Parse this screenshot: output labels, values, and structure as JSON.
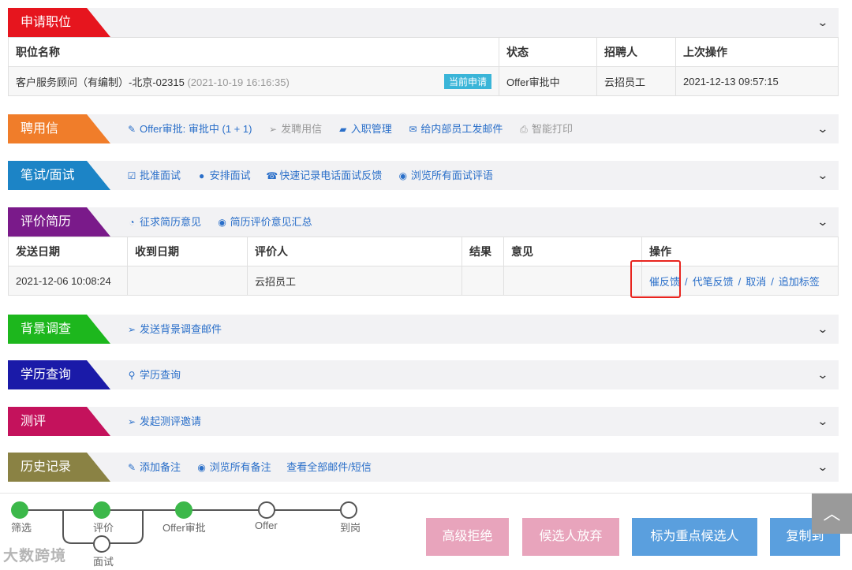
{
  "colors": {
    "apply": "#e6151e",
    "offer": "#f07d2a",
    "interview": "#1c84c6",
    "review": "#7a1a8a",
    "background": "#1db71d",
    "education": "#1a1aa8",
    "assessment": "#c4125c",
    "history": "#8a8244",
    "link": "#2a6fc9",
    "done_node": "#3cb84a"
  },
  "apply": {
    "title": "申请职位",
    "headers": [
      "职位名称",
      "状态",
      "招聘人",
      "上次操作"
    ],
    "row": {
      "position": "客户服务顾问（有编制）-北京-02315",
      "applied_time": "(2021-10-19 16:16:35)",
      "badge": "当前申请",
      "status": "Offer审批中",
      "recruiter": "云招员工",
      "last_action": "2021-12-13 09:57:15"
    }
  },
  "offer": {
    "title": "聘用信",
    "links": [
      {
        "icon": "edit-icon",
        "label": "Offer审批: 审批中 (1 + 1)"
      },
      {
        "icon": "send-icon",
        "label": "发聘用信"
      },
      {
        "icon": "briefcase-icon",
        "label": "入职管理"
      },
      {
        "icon": "mail-icon",
        "label": "给内部员工发邮件"
      },
      {
        "icon": "print-icon",
        "label": "智能打印"
      }
    ]
  },
  "interview": {
    "title": "笔试/面试",
    "links": [
      {
        "icon": "check-square-icon",
        "label": "批准面试"
      },
      {
        "icon": "user-icon",
        "label": "安排面试"
      },
      {
        "icon": "phone-icon",
        "label": "快速记录电话面试反馈"
      },
      {
        "icon": "eye-icon",
        "label": "浏览所有面试评语"
      }
    ]
  },
  "review": {
    "title": "评价简历",
    "links": [
      {
        "icon": "comments-icon",
        "label": "征求简历意见"
      },
      {
        "icon": "eye-icon",
        "label": "简历评价意见汇总"
      }
    ],
    "headers": [
      "发送日期",
      "收到日期",
      "评价人",
      "结果",
      "意见",
      "操作"
    ],
    "row": {
      "sent": "2021-12-06 10:08:24",
      "received": "",
      "reviewer": "云招员工",
      "result": "",
      "opinion": "",
      "actions": [
        "催反馈",
        "代笔反馈",
        "取消",
        "追加标签"
      ]
    }
  },
  "background": {
    "title": "背景调查",
    "links": [
      {
        "icon": "send-icon",
        "label": "发送背景调查邮件"
      }
    ]
  },
  "education": {
    "title": "学历查询",
    "links": [
      {
        "icon": "search-icon",
        "label": "学历查询"
      }
    ]
  },
  "assessment": {
    "title": "测评",
    "links": [
      {
        "icon": "send-icon",
        "label": "发起测评邀请"
      }
    ]
  },
  "history": {
    "title": "历史记录",
    "links": [
      {
        "icon": "pencil-icon",
        "label": "添加备注"
      },
      {
        "icon": "eye-icon",
        "label": "浏览所有备注"
      },
      {
        "icon": "",
        "label": "查看全部邮件/短信"
      }
    ]
  },
  "progress": {
    "steps": [
      {
        "label": "筛选",
        "done": true
      },
      {
        "label": "评价",
        "done": true
      },
      {
        "label": "Offer审批",
        "done": true
      },
      {
        "label": "Offer",
        "done": false
      },
      {
        "label": "到岗",
        "done": false
      }
    ],
    "branch_label": "面试"
  },
  "buttons": {
    "reject": "高级拒绝",
    "abandon": "候选人放弃",
    "mark_key": "标为重点候选人",
    "copy_to": "复制到"
  },
  "watermark": "大数跨境"
}
